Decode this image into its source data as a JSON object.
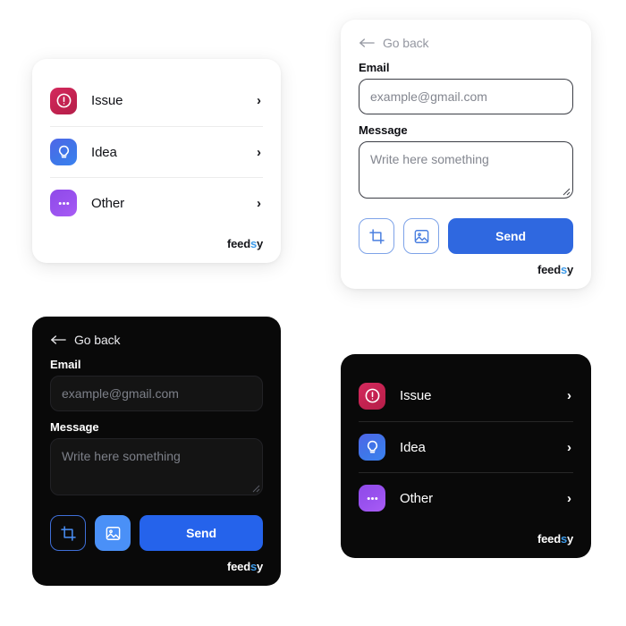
{
  "brand": {
    "prefix": "feed",
    "highlight": "s",
    "suffix": "y",
    "highlight_color": "#3d9ae8"
  },
  "colors": {
    "page_background": "#ffffff",
    "light_card_background": "#ffffff",
    "dark_card_background": "#090909",
    "send_button": "#2f68e0",
    "send_button_dark": "#2563eb",
    "issue_tile": "#c32250",
    "idea_tile": "#3f76e8",
    "other_tile": "#9a52ef",
    "icon_button_border": "#7ea3e8",
    "icon_button_filled_dark": "#4a90f7",
    "placeholder_text": "#83868f",
    "goback_text_light": "#9497a1",
    "goback_text_dark": "#e9e9ec"
  },
  "category_list": {
    "items": [
      {
        "label": "Issue",
        "icon": "exclamation-circle-icon",
        "tile": "issue",
        "chevron": "›"
      },
      {
        "label": "Idea",
        "icon": "lightbulb-icon",
        "tile": "idea",
        "chevron": "›"
      },
      {
        "label": "Other",
        "icon": "ellipsis-icon",
        "tile": "other",
        "chevron": "›"
      }
    ]
  },
  "feedback_form": {
    "back_label": "Go back",
    "back_icon": "arrow-left-icon",
    "email": {
      "label": "Email",
      "placeholder": "example@gmail.com",
      "value": ""
    },
    "message": {
      "label": "Message",
      "placeholder": "Write here something",
      "value": ""
    },
    "actions": {
      "crop_icon": "crop-icon",
      "image_icon": "image-icon",
      "send_label": "Send"
    }
  },
  "cards": [
    {
      "id": "card-list-light",
      "name": "category-list-card-light",
      "theme": "light",
      "type": "list"
    },
    {
      "id": "card-form-light",
      "name": "feedback-form-card-light",
      "theme": "light",
      "type": "form"
    },
    {
      "id": "card-form-dark",
      "name": "feedback-form-card-dark",
      "theme": "dark",
      "type": "form"
    },
    {
      "id": "card-list-dark",
      "name": "category-list-card-dark",
      "theme": "dark",
      "type": "list"
    }
  ]
}
